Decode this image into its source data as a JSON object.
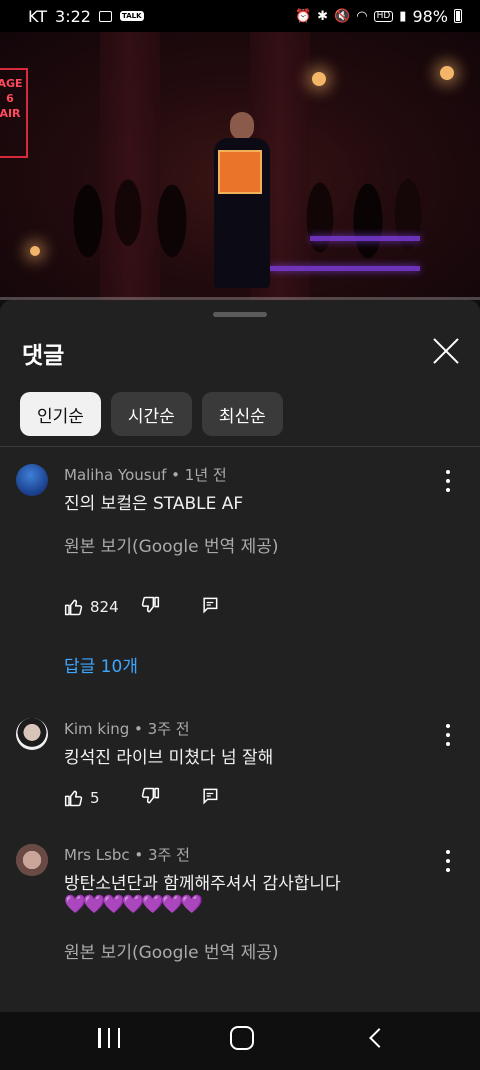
{
  "status_bar": {
    "carrier": "KT",
    "time": "3:22",
    "battery": "98%",
    "icons": [
      "gallery-icon",
      "talk-icon",
      "alarm-icon",
      "bluetooth-icon",
      "mute-icon",
      "wifi-icon",
      "hd-icon",
      "signal-icon",
      "battery-icon"
    ],
    "talk_badge": "TALK",
    "hd_badge": "HD"
  },
  "video": {
    "progress_fraction": 0.0,
    "sign_text": "AGE 6 AIR"
  },
  "comments_panel": {
    "title": "댓글",
    "sort_chips": [
      {
        "label": "인기순",
        "active": true
      },
      {
        "label": "시간순",
        "active": false
      },
      {
        "label": "최신순",
        "active": false
      }
    ],
    "comments": [
      {
        "author": "Maliha Yousuf",
        "time": "1년 전",
        "meta": "Maliha Yousuf • 1년 전",
        "text": "진의 보컬은 STABLE AF",
        "translate_label": "원본 보기(Google 번역 제공)",
        "likes": "824",
        "replies_label": "답글 10개"
      },
      {
        "author": "Kim king",
        "time": "3주 전",
        "meta": "Kim king • 3주 전",
        "text": "킹석진 라이브 미쳤다 넘 잘해",
        "likes": "5"
      },
      {
        "author": "Mrs Lsbc",
        "time": "3주 전",
        "meta": "Mrs Lsbc • 3주 전",
        "text": "방탄소년단과 함께해주셔서 감사합니다",
        "emoji": "💜💜💜💜💜💜💜",
        "translate_label": "원본 보기(Google 번역 제공)"
      }
    ]
  },
  "nav_bar": {
    "items": [
      "recent-apps-icon",
      "home-icon",
      "back-icon"
    ]
  },
  "colors": {
    "background": "#0f0f0f",
    "panel": "#212121",
    "link": "#3ea6ff",
    "secondary_text": "#aaaaaa",
    "chip_active": "#f1f1f1",
    "chip": "#3a3a3a"
  }
}
